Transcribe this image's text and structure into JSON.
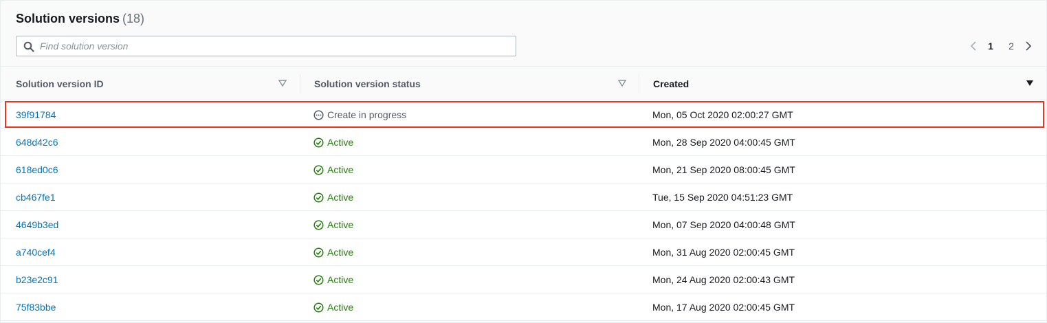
{
  "header": {
    "title": "Solution versions",
    "count": "(18)"
  },
  "search": {
    "placeholder": "Find solution version",
    "value": "",
    "icon": "search-icon"
  },
  "pagination": {
    "pages": [
      "1",
      "2"
    ],
    "current": "1",
    "prev_icon": "chevron-left-icon",
    "next_icon": "chevron-right-icon"
  },
  "table": {
    "columns": [
      "Solution version ID",
      "Solution version status",
      "Created"
    ],
    "sorted_column": "Created",
    "rows": [
      {
        "id": "39f91784",
        "status": "Create in progress",
        "status_type": "in-progress",
        "created": "Mon, 05 Oct 2020 02:00:27 GMT"
      },
      {
        "id": "648d42c6",
        "status": "Active",
        "status_type": "active",
        "created": "Mon, 28 Sep 2020 04:00:45 GMT"
      },
      {
        "id": "618ed0c6",
        "status": "Active",
        "status_type": "active",
        "created": "Mon, 21 Sep 2020 08:00:45 GMT"
      },
      {
        "id": "cb467fe1",
        "status": "Active",
        "status_type": "active",
        "created": "Tue, 15 Sep 2020 04:51:23 GMT"
      },
      {
        "id": "4649b3ed",
        "status": "Active",
        "status_type": "active",
        "created": "Mon, 07 Sep 2020 04:00:48 GMT"
      },
      {
        "id": "a740cef4",
        "status": "Active",
        "status_type": "active",
        "created": "Mon, 31 Aug 2020 02:00:45 GMT"
      },
      {
        "id": "b23e2c91",
        "status": "Active",
        "status_type": "active",
        "created": "Mon, 24 Aug 2020 02:00:43 GMT"
      },
      {
        "id": "75f83bbe",
        "status": "Active",
        "status_type": "active",
        "created": "Mon, 17 Aug 2020 02:00:45 GMT"
      }
    ]
  },
  "colors": {
    "link": "#0073bb",
    "active": "#1d8102",
    "in_progress": "#545b64",
    "highlight": "#e8361d"
  }
}
